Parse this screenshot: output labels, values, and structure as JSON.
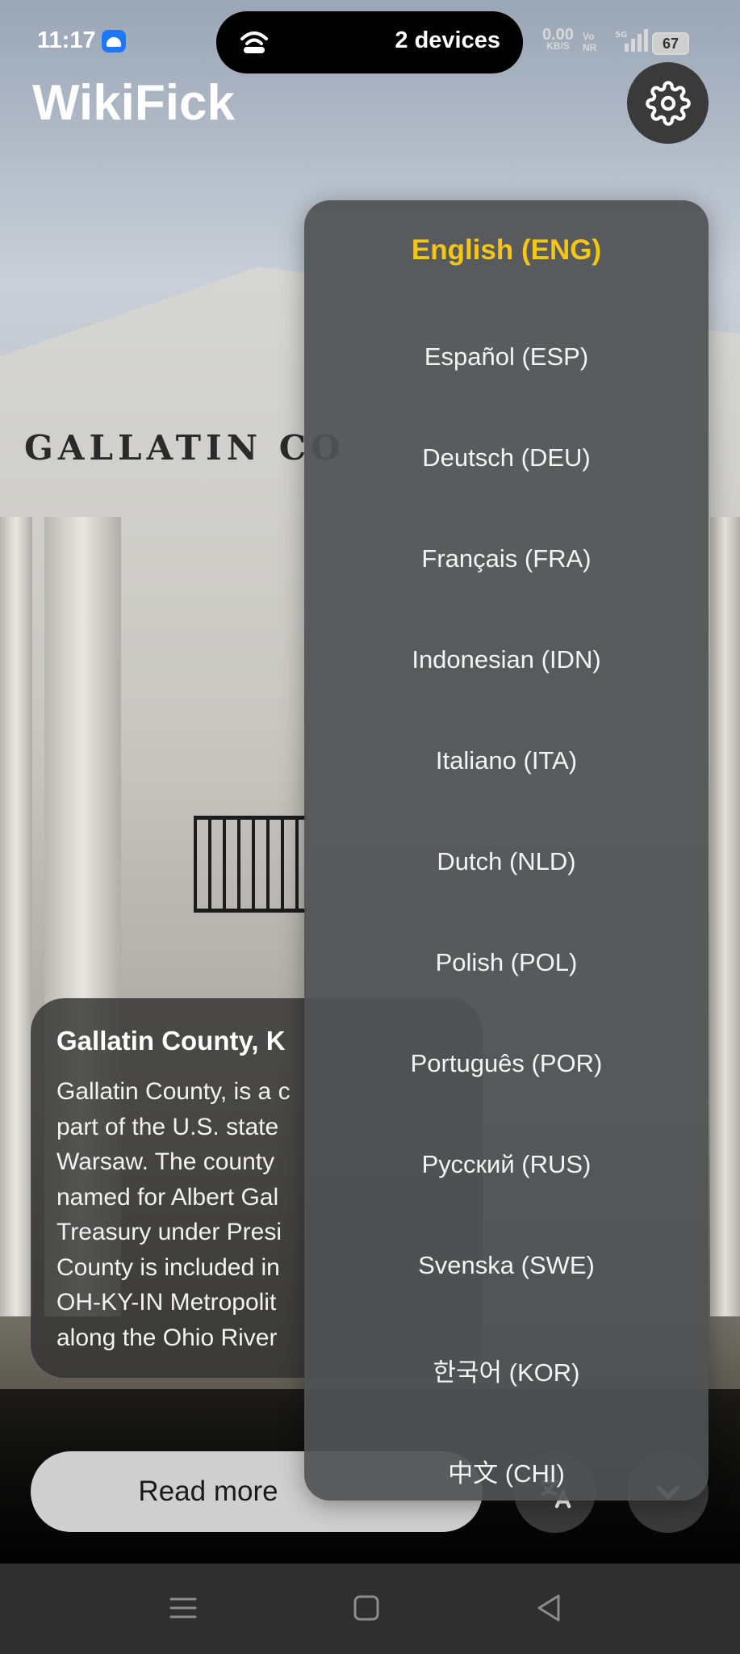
{
  "status_bar": {
    "time": "11:17",
    "pill_label": "2 devices",
    "net_speed_value": "0.00",
    "net_speed_unit": "KB/S",
    "network": "5G",
    "volte": "Vo NR",
    "battery": "67"
  },
  "app": {
    "title": "WikiFick"
  },
  "background": {
    "sign_text": "GALLATIN CO"
  },
  "article": {
    "title": "Gallatin County, K",
    "lines": [
      "Gallatin County, is a c",
      "part of the U.S. state",
      "Warsaw. The county",
      "named for Albert Gal",
      "Treasury under Presi",
      "County is included in",
      "OH-KY-IN Metropolit",
      "along the Ohio River"
    ]
  },
  "actions": {
    "read_more": "Read more"
  },
  "language_menu": {
    "selected_color": "#f5c518",
    "items": [
      {
        "label": "English (ENG)",
        "selected": true
      },
      {
        "label": "Español (ESP)",
        "selected": false
      },
      {
        "label": "Deutsch (DEU)",
        "selected": false
      },
      {
        "label": "Français (FRA)",
        "selected": false
      },
      {
        "label": "Indonesian (IDN)",
        "selected": false
      },
      {
        "label": "Italiano (ITA)",
        "selected": false
      },
      {
        "label": "Dutch (NLD)",
        "selected": false
      },
      {
        "label": "Polish (POL)",
        "selected": false
      },
      {
        "label": "Português (POR)",
        "selected": false
      },
      {
        "label": "Русский (RUS)",
        "selected": false
      },
      {
        "label": "Svenska (SWE)",
        "selected": false
      },
      {
        "label": "한국어 (KOR)",
        "selected": false
      },
      {
        "label": "中文 (CHI)",
        "selected": false
      }
    ]
  },
  "icons": {
    "settings": "gear-icon",
    "translate": "translate-icon",
    "expand": "chevron-down-icon",
    "nav_menu": "menu-icon",
    "nav_home": "home-square-icon",
    "nav_back": "back-triangle-icon"
  }
}
